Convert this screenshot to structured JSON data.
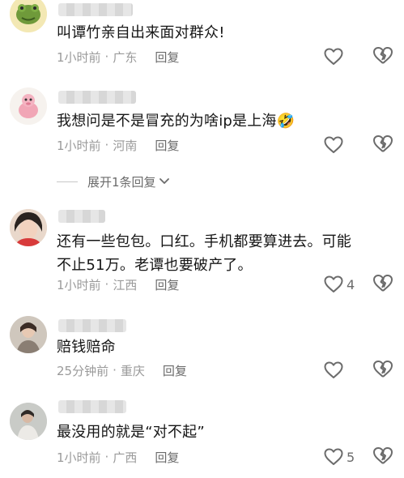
{
  "comments": [
    {
      "text": "叫谭竹亲自出来面对群众!",
      "time": "1小时前",
      "location": "广东",
      "reply": "回复",
      "likes": ""
    },
    {
      "text": "我想问是不是冒充的为啥ip是上海🤣",
      "time": "1小时前",
      "location": "河南",
      "reply": "回复",
      "likes": ""
    },
    {
      "text_line1": "还有一些包包。口红。手机都要算进去。可能",
      "text_line2": "不止51万。老谭也要破产了。",
      "time": "1小时前",
      "location": "江西",
      "reply": "回复",
      "likes": "4"
    },
    {
      "text": "赔钱赔命",
      "time": "25分钟前",
      "location": "重庆",
      "reply": "回复",
      "likes": ""
    },
    {
      "text": "最没用的就是“对不起”",
      "time": "1小时前",
      "location": "广西",
      "reply": "回复",
      "likes": "5"
    }
  ],
  "expand_replies": {
    "label": "展开1条回复"
  },
  "icons": {
    "like": "heart-outline-icon",
    "dislike": "broken-heart-icon",
    "expand": "chevron-down-icon"
  },
  "colors": {
    "meta": "#9a9a9a",
    "reply": "#6b6b6b",
    "text": "#161616"
  }
}
